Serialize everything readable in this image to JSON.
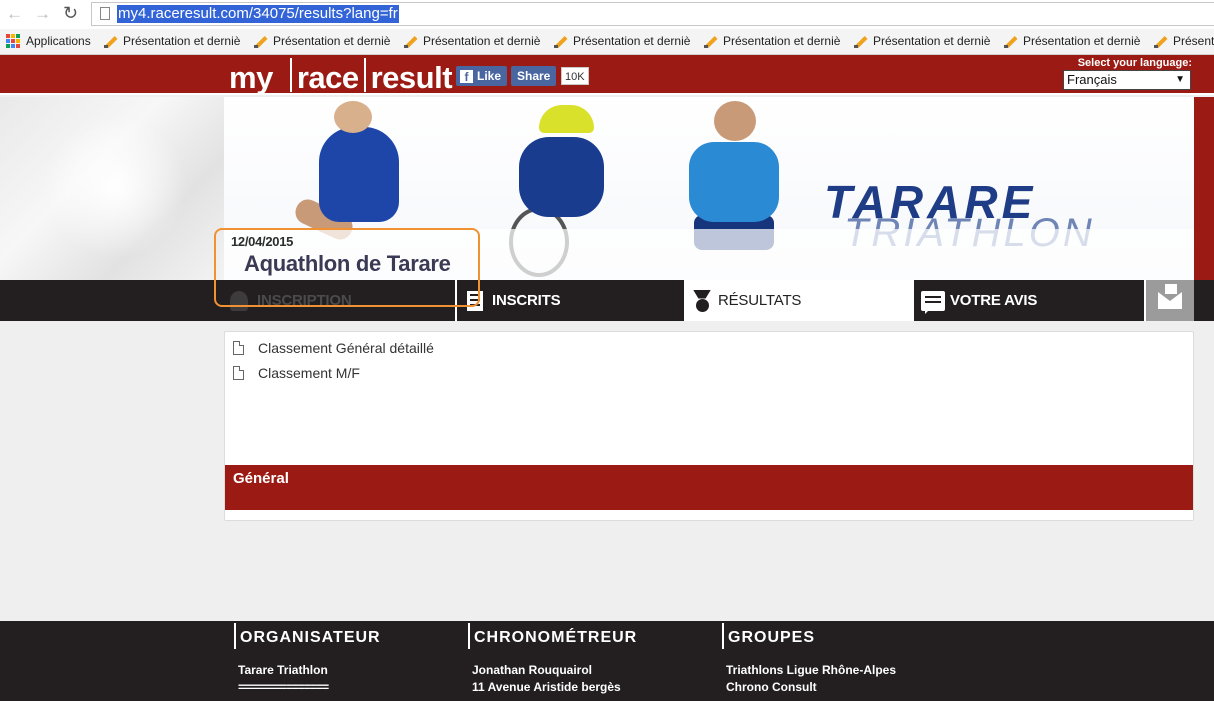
{
  "browser": {
    "url": "my4.raceresult.com/34075/results?lang=fr",
    "apps_label": "Applications",
    "bookmarks": [
      "Présentation et derniè",
      "Présentation et derniè",
      "Présentation et derniè",
      "Présentation et derniè",
      "Présentation et derniè",
      "Présentation et derniè",
      "Présentation et derniè",
      "Présent"
    ]
  },
  "header": {
    "logo": {
      "part1": "my",
      "part2": "race",
      "part3": "result"
    },
    "fb_like": "Like",
    "fb_share": "Share",
    "fb_count": "10K",
    "language_label": "Select your language:",
    "language_value": "Français"
  },
  "hero": {
    "brand_line1": "TARARE",
    "brand_line2": "TRIATHLON"
  },
  "event": {
    "date": "12/04/2015",
    "name": "Aquathlon de Tarare"
  },
  "nav": {
    "inscription": "INSCRIPTION",
    "inscrits": "INSCRITS",
    "resultats": "RÉSULTATS",
    "avis": "VOTRE AVIS"
  },
  "results": {
    "links": [
      "Classement Général détaillé",
      "Classement M/F"
    ],
    "section_title": "Général"
  },
  "footer": {
    "organisateur": {
      "title": "ORGANISATEUR",
      "lines": [
        "Tarare Triathlon",
        "==============="
      ]
    },
    "chronometreur": {
      "title": "CHRONOMÉTREUR",
      "lines": [
        "Jonathan Rouquairol",
        "11 Avenue Aristide bergès"
      ]
    },
    "groupes": {
      "title": "GROUPES",
      "lines": [
        "Triathlons Ligue Rhône-Alpes",
        "Chrono Consult"
      ]
    }
  },
  "colors": {
    "brand_red": "#9b1b14",
    "nav_dark": "#231f20",
    "highlight_orange": "#f09234"
  }
}
